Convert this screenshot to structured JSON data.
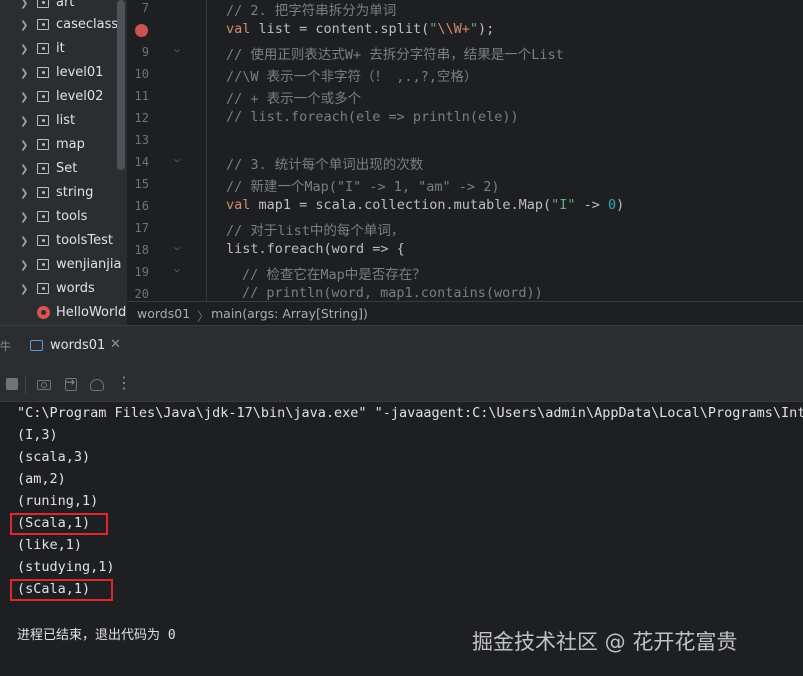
{
  "project_tree": {
    "items": [
      {
        "label": "art"
      },
      {
        "label": "caseclass"
      },
      {
        "label": "it"
      },
      {
        "label": "level01"
      },
      {
        "label": "level02"
      },
      {
        "label": "list"
      },
      {
        "label": "map"
      },
      {
        "label": "Set"
      },
      {
        "label": "string"
      },
      {
        "label": "tools"
      },
      {
        "label": "toolsTest"
      },
      {
        "label": "wenjianjia"
      },
      {
        "label": "words"
      }
    ],
    "hello_world": "HelloWorld"
  },
  "editor": {
    "lines": [
      {
        "num": "7",
        "text": "// 2. 把字符串拆分为单词"
      },
      {
        "num": "",
        "text": ""
      },
      {
        "num": "9",
        "text": "// 使用正则表达式W+ 去拆分字符串，结果是一个List"
      },
      {
        "num": "10",
        "text": "//\\W 表示一个非字符（！ ,.,?,空格）"
      },
      {
        "num": "11",
        "text": "// + 表示一个或多个"
      },
      {
        "num": "12",
        "text": "// list.foreach(ele => println(ele))"
      },
      {
        "num": "13",
        "text": ""
      },
      {
        "num": "14",
        "text": "// 3. 统计每个单词出现的次数"
      },
      {
        "num": "15",
        "text": "// 新建一个Map(\"I\" -> 1, \"am\" -> 2)"
      },
      {
        "num": "16",
        "text": ""
      },
      {
        "num": "17",
        "text": "// 对于list中的每个单词，"
      },
      {
        "num": "18",
        "text": ""
      },
      {
        "num": "19",
        "text": "// 检查它在Map中是否存在？"
      },
      {
        "num": "20",
        "text": "// println(word, map1.contains(word))"
      }
    ],
    "line8": {
      "kw": "val",
      "rest": " list = content.split(",
      "str_open": "\"",
      "esc": "\\\\W+",
      "str_close": "\"",
      "end": ");"
    },
    "line16": {
      "kw": "val",
      "rest": " map1 = scala.collection.mutable.Map(",
      "str": "\"I\"",
      "arrow": " -> ",
      "num": "0",
      "end": ")"
    },
    "line18": {
      "text": "list.foreach(word => {"
    }
  },
  "breadcrumb": {
    "object": "words01",
    "method": "main(args: Array[String])"
  },
  "run_panel": {
    "tab_label": "words01",
    "left_edge_glyph": "牛",
    "command": "\"C:\\Program Files\\Java\\jdk-17\\bin\\java.exe\" \"-javaagent:C:\\Users\\admin\\AppData\\Local\\Programs\\Inte",
    "output": [
      "(I,3)",
      "(scala,3)",
      "(am,2)",
      "(runing,1)",
      "(Scala,1)",
      "(like,1)",
      "(studying,1)",
      "(sCala,1)"
    ],
    "exit_message": "进程已结束，退出代码为 0"
  },
  "watermark": "掘金技术社区 @ 花开花富贵",
  "colors": {
    "highlight_box": "#e0272c",
    "breakpoint": "#c75450",
    "keyword": "#cf8e6d",
    "string": "#6aab73",
    "number": "#2aacb8",
    "comment": "#7a7e85"
  }
}
